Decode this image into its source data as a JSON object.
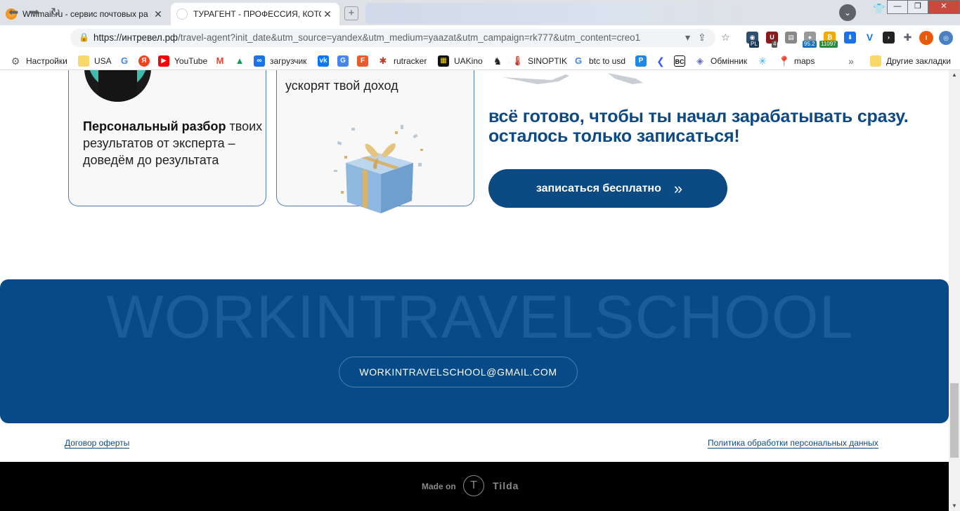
{
  "browser": {
    "tabs": [
      {
        "title": "WMmail.ru - сервис почтовых ра",
        "active": false
      },
      {
        "title": "ТУРАГЕНТ - ПРОФЕССИЯ, КОТОРА",
        "active": true
      }
    ],
    "new_tab": "+",
    "profile_initial": "",
    "window_buttons": {
      "minimize": "—",
      "maximize": "❐",
      "close": "✕"
    },
    "url_host": "https://интревел.рф",
    "url_rest": "/travel-agent?init_date&utm_source=yandex&utm_medium=yaazat&utm_campaign=rk777&utm_content=creo1",
    "extension_badges": [
      "PL",
      "4",
      "95.2",
      "11097"
    ],
    "ext_profile_initial": "I",
    "bookmarks": [
      {
        "label": "Настройки",
        "icon": "gear-icon"
      },
      {
        "label": "USA",
        "icon": "folder-icon"
      },
      {
        "label": "",
        "icon": "google-icon"
      },
      {
        "label": "",
        "icon": "yandex-icon"
      },
      {
        "label": "YouTube",
        "icon": "youtube-icon"
      },
      {
        "label": "",
        "icon": "gmail-icon"
      },
      {
        "label": "",
        "icon": "drive-icon"
      },
      {
        "label": "загрузчик",
        "icon": "loop-icon"
      },
      {
        "label": "",
        "icon": "vk-icon"
      },
      {
        "label": "",
        "icon": "translate-icon"
      },
      {
        "label": "",
        "icon": "f-icon"
      },
      {
        "label": "rutracker",
        "icon": "rutracker-icon"
      },
      {
        "label": "UAKino",
        "icon": "uakino-icon"
      },
      {
        "label": "",
        "icon": "chess-icon"
      },
      {
        "label": "SINOPTIK",
        "icon": "thermometer-icon"
      },
      {
        "label": "btc to usd",
        "icon": "google-icon"
      },
      {
        "label": "",
        "icon": "p-icon"
      },
      {
        "label": "",
        "icon": "arrow-icon"
      },
      {
        "label": "",
        "icon": "bc-icon"
      },
      {
        "label": "Обмінник",
        "icon": "exchange-icon"
      },
      {
        "label": "",
        "icon": "star-icon"
      },
      {
        "label": "maps",
        "icon": "maps-icon"
      }
    ],
    "bookmarks_more": "»",
    "other_bookmarks": "Другие закладки"
  },
  "page": {
    "card1": {
      "bold": "Персональный разбор",
      "text": " твоих результатов от эксперта – доведём до результата"
    },
    "card2": {
      "text": "ускорят твой доход"
    },
    "cta_heading": "всё готово, чтобы ты начал зарабатывать сразу. осталось только записаться!",
    "cta_button": "записаться бесплатно",
    "cta_arrow": "»",
    "brand": "WORKINTRAVELSCHOOL",
    "email": "WORKINTRAVELSCHOOL@GMAIL.COM",
    "offer_link": "Договор оферты",
    "privacy_link": "Политика обработки персональных данных",
    "made_on": "Made on",
    "tilda_logo": "T",
    "tilda": "Tilda"
  },
  "colors": {
    "brand_blue": "#0c4a84",
    "band_blue": "#074a88"
  }
}
